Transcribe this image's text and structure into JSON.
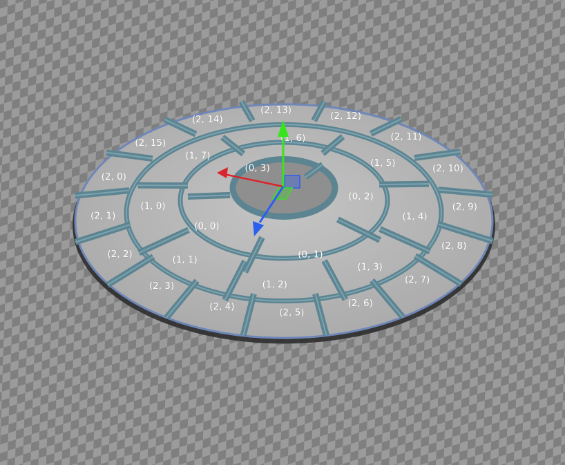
{
  "viewport": {
    "background": "#8d8d8d",
    "checker_light": "#9b9b9b",
    "checker_dark": "#7d7d7d"
  },
  "disc": {
    "surface_color": "#b7b7b7",
    "wall_color": "#5d8491",
    "wall_light": "#7ca3af",
    "edge_color": "#6f87b8"
  },
  "gizmo": {
    "x_axis_color": "#d9252b",
    "y_axis_color": "#36e51c",
    "z_axis_color": "#2a5ff0"
  },
  "cell_labels": {
    "ring0": [
      "(0, 0)",
      "(0, 1)",
      "(0, 2)",
      "(0, 3)"
    ],
    "ring1": [
      "(1, 0)",
      "(1, 1)",
      "(1, 2)",
      "(1, 3)",
      "(1, 4)",
      "(1, 5)",
      "(1, 6)",
      "(1, 7)"
    ],
    "ring2": [
      "(2, 0)",
      "(2, 1)",
      "(2, 2)",
      "(2, 3)",
      "(2, 4)",
      "(2, 5)",
      "(2, 6)",
      "(2, 7)",
      "(2, 8)",
      "(2, 9)",
      "(2, 10)",
      "(2, 11)",
      "(2, 12)",
      "(2, 13)",
      "(2, 14)",
      "(2, 15)"
    ]
  }
}
